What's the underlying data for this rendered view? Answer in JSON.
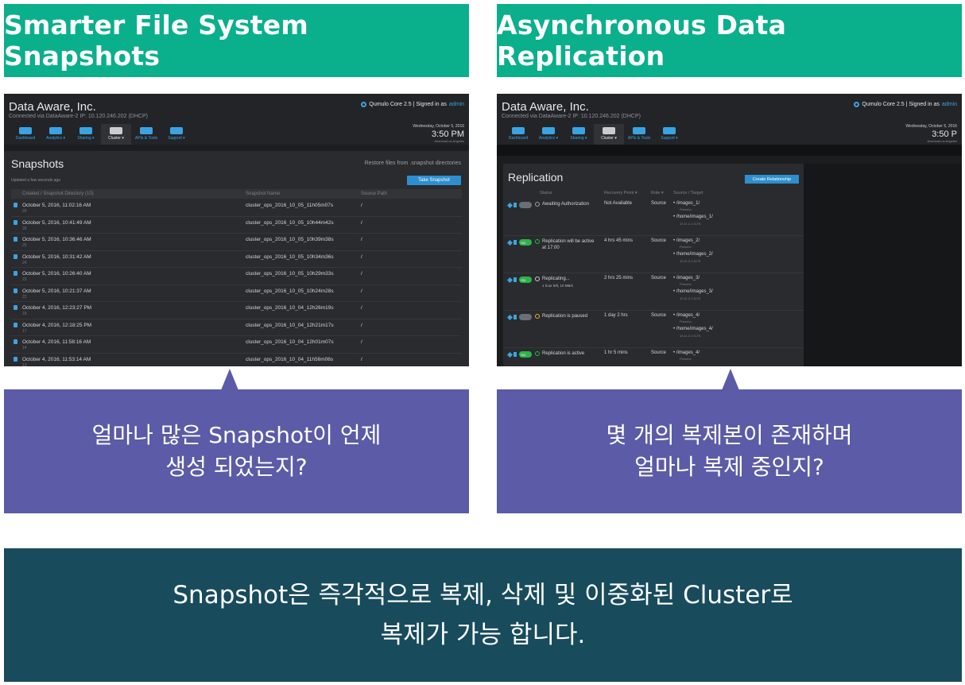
{
  "left": {
    "header": "Smarter File System Snapshots",
    "caption_lines": [
      "얼마나 많은 Snapshot이 언제",
      "생성 되었는지?"
    ],
    "app": {
      "company": "Data Aware, Inc.",
      "connection": "Connected via DataAware-2 IP: 10.120.246.202 (DHCP)",
      "product": "Qumulo Core 2.5 | Signed in as",
      "user": "admin",
      "nav": [
        "Dashboard",
        "Analytics ▾",
        "Sharing ▾",
        "Cluster ▾",
        "APIs & Tools",
        "Support ▾"
      ],
      "date": "Wednesday, October 5, 2016",
      "time": "3:50 PM",
      "timezone": "America/Los Angeles"
    },
    "snapshots": {
      "title": "Snapshots",
      "restore_link": "Restore files from .snapshot directories",
      "updated": "Updated a few seconds ago",
      "take_button": "Take Snapshot",
      "columns": [
        "Created / Snapshot Directory (10)",
        "Snapshot Name",
        "Source Path"
      ],
      "rows": [
        {
          "created": "October 5, 2016, 11:02:16 AM",
          "num": "29",
          "name": "cluster_ops_2016_10_05_11h05m07s",
          "path": "/"
        },
        {
          "created": "October 5, 2016, 10:41:49 AM",
          "num": "26",
          "name": "cluster_ops_2016_10_05_10h44m42s",
          "path": "/"
        },
        {
          "created": "October 5, 2016, 10:36:46 AM",
          "num": "25",
          "name": "cluster_ops_2016_10_05_10h39m38s",
          "path": "/"
        },
        {
          "created": "October 5, 2016, 10:31:42 AM",
          "num": "24",
          "name": "cluster_ops_2016_10_05_10h34m36s",
          "path": "/"
        },
        {
          "created": "October 5, 2016, 10:26:40 AM",
          "num": "23",
          "name": "cluster_ops_2016_10_05_10h29m33s",
          "path": "/"
        },
        {
          "created": "October 5, 2016, 10:21:37 AM",
          "num": "22",
          "name": "cluster_ops_2016_10_05_10h24m28s",
          "path": "/"
        },
        {
          "created": "October 4, 2016, 12:23:27 PM",
          "num": "18",
          "name": "cluster_ops_2016_10_04_12h26m19s",
          "path": "/"
        },
        {
          "created": "October 4, 2016, 12:18:25 PM",
          "num": "17",
          "name": "cluster_ops_2016_10_04_12h21m17s",
          "path": "/"
        },
        {
          "created": "October 4, 2016, 11:58:16 AM",
          "num": "14",
          "name": "cluster_ops_2016_10_04_12h01m07s",
          "path": "/"
        },
        {
          "created": "October 4, 2016, 11:53:14 AM",
          "num": "13",
          "name": "cluster_ops_2016_10_04_11h56m06s",
          "path": "/"
        }
      ]
    }
  },
  "right": {
    "header": "Asynchronous Data Replication",
    "caption_lines": [
      "몇 개의 복제본이 존재하며",
      "얼마나 복제 중인지?"
    ],
    "app": {
      "company": "Data Aware, Inc.",
      "connection": "Connected via DataAware-2 IP: 10.120.246.202 (DHCP)",
      "product": "Qumulo Core 2.5 | Signed in as",
      "user": "admin",
      "nav": [
        "Dashboard",
        "Analytics ▾",
        "Sharing ▾",
        "Cluster ▾",
        "APIs & Tools",
        "Support ▾"
      ],
      "date": "Wednesday, October 5, 2016",
      "time": "3:50 P",
      "timezone": "America/Los Angeles"
    },
    "replication": {
      "title": "Replication",
      "create_button": "Create Relationship",
      "columns": [
        "Status",
        "Recovery Point ▾",
        "Role ▾",
        "Source / Target"
      ],
      "rows": [
        {
          "toggle": "off",
          "toggle_label": "",
          "status": "Awaiting Authorization",
          "status_sub": "",
          "recovery": "Not Available",
          "role": "Source",
          "source": "/images_1/",
          "source_host": "Prescho",
          "target": "/home/images_1/",
          "target_host": "10.11.2.1:1175",
          "color": "#9aa0a6"
        },
        {
          "toggle": "on",
          "toggle_label": "ON",
          "status": "Replication will be active at 17:00",
          "status_sub": "",
          "recovery": "4 hrs 45 mins",
          "role": "Source",
          "source": "/images_2/",
          "source_host": "Prescho",
          "target": "/home/images_2/",
          "target_host": "10.11.2.1:1175",
          "color": "#2db34a"
        },
        {
          "toggle": "on",
          "toggle_label": "ON",
          "status": "Replicating...",
          "status_sub": "1 hour left, 10 MB/s",
          "recovery": "2 hrs 25 mins",
          "role": "Source",
          "source": "/images_3/",
          "source_host": "Prescho",
          "target": "/home/images_3/",
          "target_host": "10.11.2.1:1175",
          "color": "#c9cdd2"
        },
        {
          "toggle": "off",
          "toggle_label": "",
          "status": "Replication is paused",
          "status_sub": "",
          "recovery": "1 day 2 hrs",
          "role": "Source",
          "source": "/images_4/",
          "source_host": "Prescho",
          "target": "/home/images_4/",
          "target_host": "10.11.2.1:1175",
          "color": "#e8b32a"
        },
        {
          "toggle": "on",
          "toggle_label": "ON",
          "status": "Replication is active",
          "status_sub": "",
          "recovery": "1 hr 5 mins",
          "role": "Source",
          "source": "/images_4/",
          "source_host": "Prescho",
          "target": "",
          "target_host": "",
          "color": "#2db34a"
        }
      ]
    }
  },
  "summary_lines": [
    "Snapshot은 즉각적으로 복제, 삭제 및 이중화된 Cluster로",
    "복제가 가능 합니다."
  ]
}
